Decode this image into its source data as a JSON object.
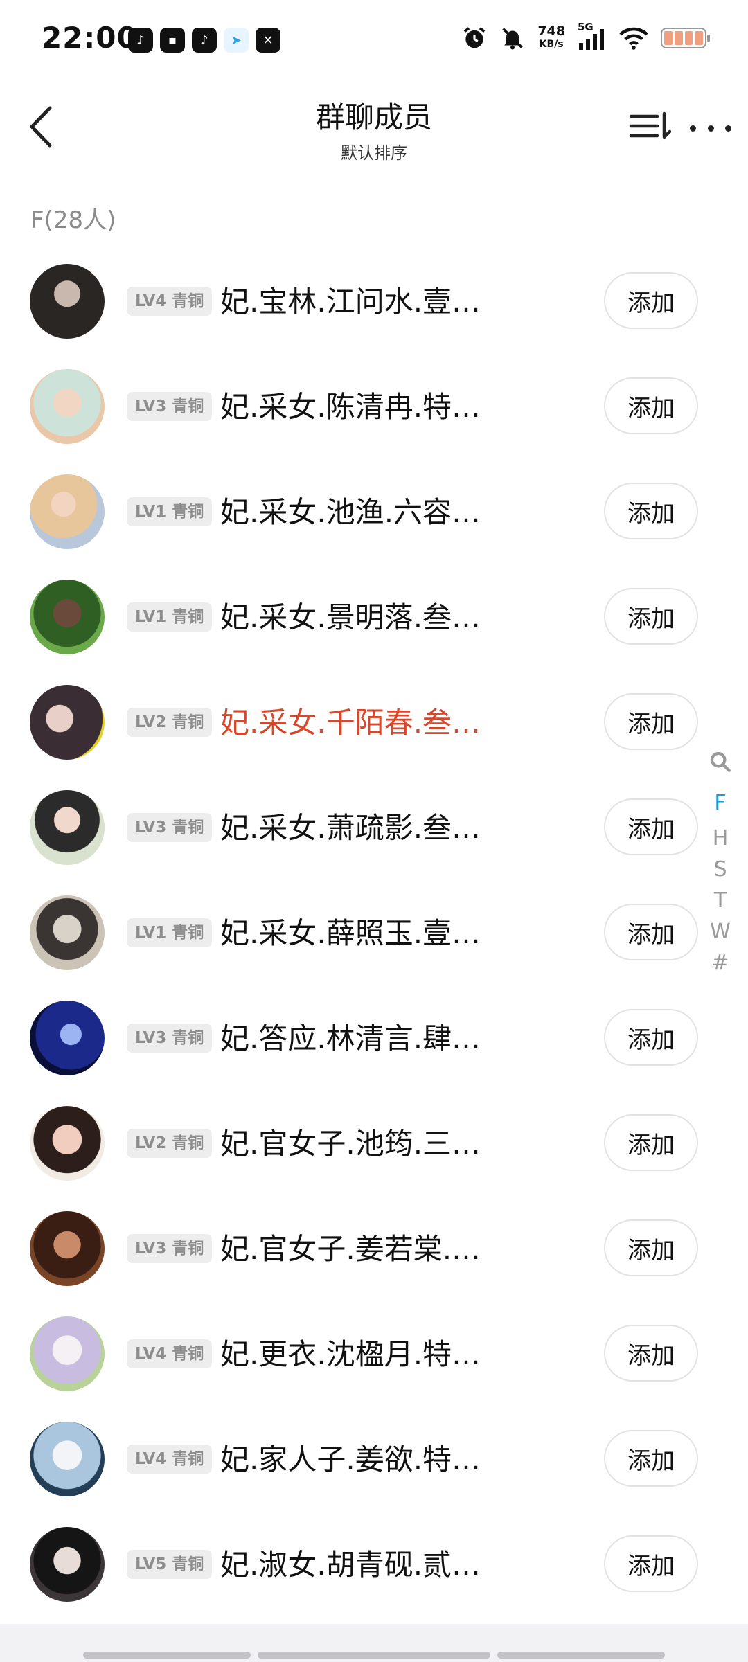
{
  "status": {
    "time": "22:00",
    "net_speed": "748",
    "net_unit": "KB/s",
    "signal_label": "5G",
    "app_icons": [
      "douyin-icon",
      "app-icon",
      "tiktok-icon",
      "telegram-icon",
      "capcut-icon"
    ],
    "indicator_icons": [
      "alarm-icon",
      "mute-icon",
      "signal-icon",
      "wifi-icon",
      "battery-icon"
    ]
  },
  "header": {
    "title": "群聊成员",
    "subtitle": "默认排序"
  },
  "section": {
    "label": "F(28人)"
  },
  "add_label": "添加",
  "colors": {
    "highlight_name": "#d8472a",
    "active_index": "#1a9ad6",
    "badge_bg": "#ededed"
  },
  "members": [
    {
      "level": "LV4 青铜",
      "name": "妃.宝林.江问水.壹…",
      "highlight": false
    },
    {
      "level": "LV3 青铜",
      "name": "妃.采女.陈清冉.特…",
      "highlight": false
    },
    {
      "level": "LV1 青铜",
      "name": "妃.采女.池渔.六容…",
      "highlight": false
    },
    {
      "level": "LV1 青铜",
      "name": "妃.采女.景明落.叁…",
      "highlight": false
    },
    {
      "level": "LV2 青铜",
      "name": "妃.采女.千陌春.叁…",
      "highlight": true
    },
    {
      "level": "LV3 青铜",
      "name": "妃.采女.萧疏影.叁…",
      "highlight": false
    },
    {
      "level": "LV1 青铜",
      "name": "妃.采女.薛照玉.壹…",
      "highlight": false
    },
    {
      "level": "LV3 青铜",
      "name": "妃.答应.林清言.肆…",
      "highlight": false
    },
    {
      "level": "LV2 青铜",
      "name": "妃.官女子.池筠.三…",
      "highlight": false
    },
    {
      "level": "LV3 青铜",
      "name": "妃.官女子.姜若棠.…",
      "highlight": false
    },
    {
      "level": "LV4 青铜",
      "name": "妃.更衣.沈楹月.特…",
      "highlight": false
    },
    {
      "level": "LV4 青铜",
      "name": "妃.家人子.姜欲.特…",
      "highlight": false
    },
    {
      "level": "LV5 青铜",
      "name": "妃.淑女.胡青砚.贰…",
      "highlight": false
    }
  ],
  "index_bar": {
    "search_icon": "search-icon",
    "letters": [
      "F",
      "H",
      "S",
      "T",
      "W",
      "#"
    ],
    "active": "F"
  }
}
